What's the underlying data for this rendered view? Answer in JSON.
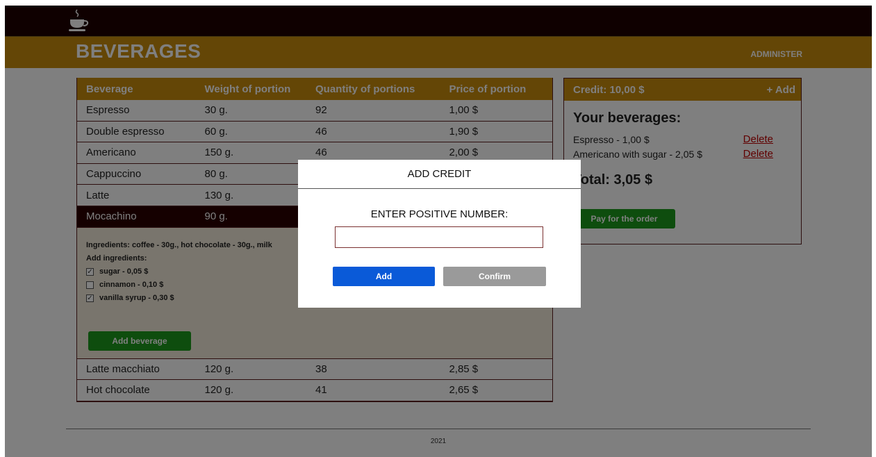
{
  "header": {
    "title": "BEVERAGES",
    "admin_link": "ADMINISTER"
  },
  "menu": {
    "columns": [
      "Beverage",
      "Weight of portion",
      "Quantity of portions",
      "Price of portion"
    ],
    "rows": [
      [
        "Espresso",
        "30 g.",
        "92",
        "1,00 $"
      ],
      [
        "Double espresso",
        "60 g.",
        "46",
        "1,90 $"
      ],
      [
        "Americano",
        "150 g.",
        "46",
        "2,00 $"
      ],
      [
        "Cappuccino",
        "80 g.",
        "",
        ""
      ],
      [
        "Latte",
        "130 g.",
        "",
        ""
      ],
      [
        "Mocachino",
        "90 g.",
        "",
        ""
      ],
      [
        "Latte macchiato",
        "120 g.",
        "38",
        "2,85 $"
      ],
      [
        "Hot chocolate",
        "120 g.",
        "41",
        "2,65 $"
      ]
    ],
    "selected_detail": {
      "ingredients": "Ingredients: coffee - 30g., hot chocolate - 30g., milk",
      "add_ingredients_label": "Add ingredients:",
      "options": [
        {
          "label": "sugar - 0,05 $",
          "checked": true
        },
        {
          "label": "cinnamon - 0,10 $",
          "checked": false
        },
        {
          "label": "vanilla syrup - 0,30 $",
          "checked": true
        }
      ],
      "add_button": "Add beverage"
    }
  },
  "cart": {
    "credit": "Credit: 10,00 $",
    "add_credit": "+ Add",
    "heading": "Your beverages:",
    "items": [
      {
        "name": "Espresso - 1,00 $",
        "delete": "Delete"
      },
      {
        "name": "Americano with sugar - 2,05 $",
        "delete": "Delete"
      }
    ],
    "total": "Total: 3,05 $",
    "pay_button": "Pay for the order"
  },
  "footer": {
    "year": "2021"
  },
  "modal": {
    "title": "ADD CREDIT",
    "label": "ENTER POSITIVE NUMBER:",
    "input_value": "",
    "add_button": "Add",
    "confirm_button": "Confirm"
  },
  "colors": {
    "header": "#c98c0c",
    "topbar": "#1e0000",
    "primary": "#0a5ad8",
    "success": "#1c9a1c",
    "danger": "#c00000"
  }
}
